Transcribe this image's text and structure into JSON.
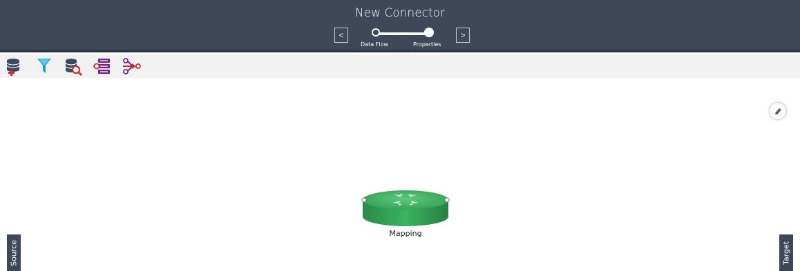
{
  "header": {
    "title": "New Connector",
    "prev_label": "<",
    "next_label": ">",
    "steps": [
      {
        "label": "Data Flow",
        "state": "current"
      },
      {
        "label": "Properties",
        "state": "completed"
      }
    ]
  },
  "toolbar": {
    "tools": [
      {
        "icon": "add-source-icon"
      },
      {
        "icon": "filter-icon"
      },
      {
        "icon": "lookup-icon"
      },
      {
        "icon": "mapping-list-icon"
      },
      {
        "icon": "connector-flow-icon"
      }
    ]
  },
  "canvas": {
    "eraser_icon": "eraser-icon",
    "node": {
      "label": "Mapping",
      "icon": "mapping-router-icon"
    }
  },
  "side_tabs": {
    "source": "Source",
    "target": "Target"
  },
  "colors": {
    "header_bg": "#3e4858",
    "toolbar_bg": "#f2f2f2",
    "node_green": "#3aa15a",
    "accent_blue": "#1fa2d6",
    "accent_purple": "#7a1f8e",
    "accent_red": "#d8262f"
  }
}
